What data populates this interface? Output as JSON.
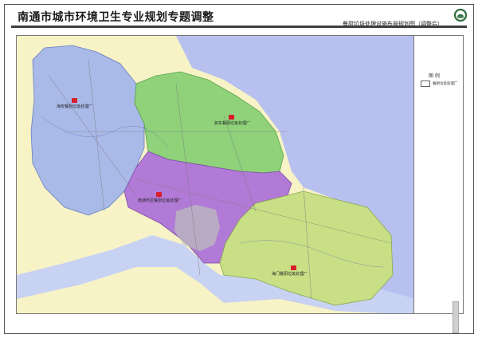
{
  "header": {
    "title": "南通市城市环境卫生专业规划专题调整",
    "subtitle": "餐厨垃圾处理设施布局规划图（调整后）"
  },
  "legend": {
    "title": "图 例",
    "item_label": "餐厨垃圾处理厂"
  },
  "map": {
    "facilities": [
      {
        "label": "海安餐厨垃圾处理厂"
      },
      {
        "label": "如东餐厨垃圾处理厂"
      },
      {
        "label": "南通市区餐厨垃圾处理厂"
      },
      {
        "label": "海门餐厨垃圾处理厂"
      }
    ],
    "colors": {
      "haian": "#a9b9e8",
      "rudong": "#8fd27a",
      "shiqu": "#b17ad6",
      "haimen": "#c8df86",
      "sea": "#b7c0ef",
      "river": "#c8d2f2",
      "land_outside": "#f7f3c7",
      "marker": "#d81e2a"
    }
  }
}
